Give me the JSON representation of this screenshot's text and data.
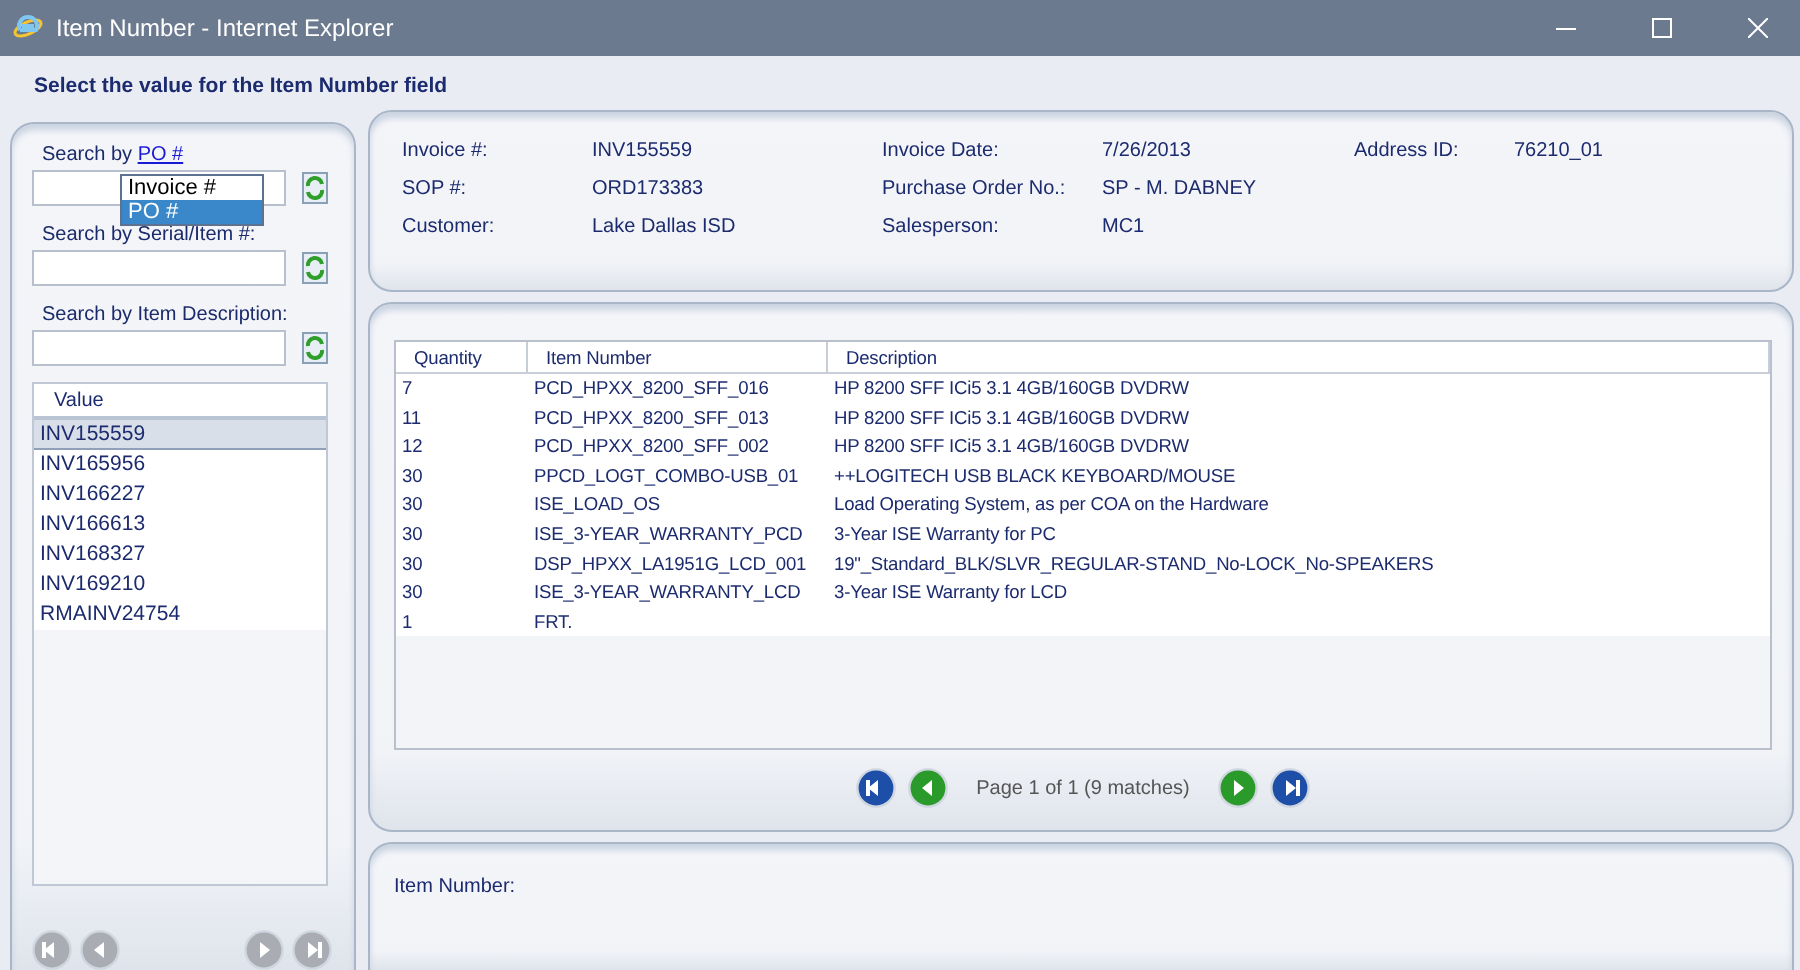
{
  "window": {
    "title": "Item Number - Internet Explorer"
  },
  "instruction": "Select the value for the Item Number field",
  "search": {
    "by_label": "Search by",
    "by_link": "PO #",
    "dropdown": [
      {
        "label": "Invoice #",
        "selected": false
      },
      {
        "label": "PO #",
        "selected": true
      }
    ],
    "fields": [
      {
        "label": "Search by Serial/Item #:"
      },
      {
        "label": "Search by Item Description:"
      }
    ]
  },
  "values": {
    "header": "Value",
    "rows": [
      {
        "value": "INV155559",
        "selected": true
      },
      {
        "value": "INV165956",
        "selected": false
      },
      {
        "value": "INV166227",
        "selected": false
      },
      {
        "value": "INV166613",
        "selected": false
      },
      {
        "value": "INV168327",
        "selected": false
      },
      {
        "value": "INV169210",
        "selected": false
      },
      {
        "value": "RMAINV24754",
        "selected": false
      }
    ],
    "pager_disabled": true
  },
  "details": [
    [
      {
        "label": "Invoice #:",
        "value": "INV155559"
      },
      {
        "label": "Invoice Date:",
        "value": "7/26/2013"
      },
      {
        "label": "Address ID:",
        "value": "76210_01"
      }
    ],
    [
      {
        "label": "SOP #:",
        "value": "ORD173383"
      },
      {
        "label": "Purchase Order No.:",
        "value": "SP - M. DABNEY"
      }
    ],
    [
      {
        "label": "Customer:",
        "value": "Lake Dallas ISD"
      },
      {
        "label": "Salesperson:",
        "value": "MC1"
      }
    ]
  ],
  "table": {
    "columns": [
      "Quantity",
      "Item Number",
      "Description"
    ],
    "rows": [
      [
        "7",
        "PCD_HPXX_8200_SFF_016",
        "HP 8200 SFF ICi5 3.1 4GB/160GB DVDRW"
      ],
      [
        "11",
        "PCD_HPXX_8200_SFF_013",
        "HP 8200 SFF ICi5 3.1 4GB/160GB DVDRW"
      ],
      [
        "12",
        "PCD_HPXX_8200_SFF_002",
        "HP 8200 SFF ICi5 3.1 4GB/160GB DVDRW"
      ],
      [
        "30",
        "PPCD_LOGT_COMBO-USB_01",
        "++LOGITECH USB BLACK KEYBOARD/MOUSE"
      ],
      [
        "30",
        "ISE_LOAD_OS",
        "Load Operating System, as per COA on the Hardware"
      ],
      [
        "30",
        "ISE_3-YEAR_WARRANTY_PCD",
        "3-Year ISE Warranty for PC"
      ],
      [
        "30",
        "DSP_HPXX_LA1951G_LCD_001",
        "19\"_Standard_BLK/SLVR_REGULAR-STAND_No-LOCK_No-SPEAKERS"
      ],
      [
        "30",
        "ISE_3-YEAR_WARRANTY_LCD",
        "3-Year ISE Warranty for LCD"
      ],
      [
        "1",
        "FRT.",
        ""
      ]
    ]
  },
  "pager": "Page 1 of 1 (9 matches)",
  "footer": {
    "label": "Item Number:"
  }
}
